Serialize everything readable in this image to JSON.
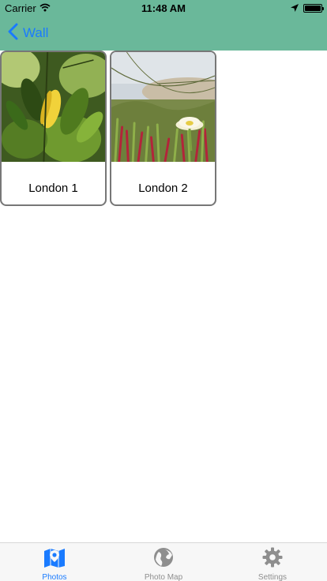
{
  "status_bar": {
    "carrier": "Carrier",
    "time": "11:48 AM",
    "battery_level": 1.0
  },
  "nav": {
    "back_label": "Wall",
    "bar_color": "#6ab89a",
    "tint_color": "#1a7bff"
  },
  "photos": [
    {
      "label": "London 1",
      "image": "yellow leaf among green leaves"
    },
    {
      "label": "London 2",
      "image": "white flower among succulents with grass"
    }
  ],
  "tabbar": {
    "tabs": [
      {
        "label": "Photos",
        "icon": "map-pin-icon",
        "active": true
      },
      {
        "label": "Photo Map",
        "icon": "globe-icon",
        "active": false
      },
      {
        "label": "Settings",
        "icon": "gear-icon",
        "active": false
      }
    ]
  }
}
